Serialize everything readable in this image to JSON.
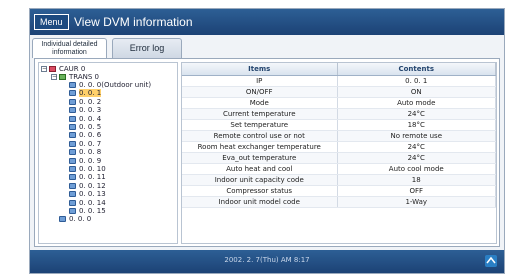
{
  "window": {
    "menu_label": "Menu",
    "title": "View DVM information"
  },
  "tabs": [
    {
      "label": "Individual detailed information",
      "active": true
    },
    {
      "label": "Error log",
      "active": false
    }
  ],
  "tree": {
    "root": "CAUR 0",
    "trans": "TRANS 0",
    "items": [
      "0. 0. 0(Outdoor unit)",
      "0. 0. 1",
      "0. 0. 2",
      "0. 0. 3",
      "0. 0. 4",
      "0. 0. 5",
      "0. 0. 6",
      "0. 0. 7",
      "0. 0. 8",
      "0. 0. 9",
      "0. 0. 10",
      "0. 0. 11",
      "0. 0. 12",
      "0. 0. 13",
      "0. 0. 14",
      "0. 0. 15",
      "0. 0. 0"
    ],
    "selected_index": 1
  },
  "table": {
    "headers": [
      "Items",
      "Contents"
    ],
    "rows": [
      [
        "IP",
        "0. 0. 1"
      ],
      [
        "ON/OFF",
        "ON"
      ],
      [
        "Mode",
        "Auto mode"
      ],
      [
        "Current temperature",
        "24°C"
      ],
      [
        "Set temperature",
        "18°C"
      ],
      [
        "Remote control use or not",
        "No remote use"
      ],
      [
        "Room heat exchanger temperature",
        "24°C"
      ],
      [
        "Eva_out temperature",
        "24°C"
      ],
      [
        "Auto heat and cool",
        "Auto cool mode"
      ],
      [
        "Indoor unit capacity code",
        "18"
      ],
      [
        "Compressor status",
        "OFF"
      ],
      [
        "Indoor unit model code",
        "1-Way"
      ]
    ]
  },
  "status": {
    "datetime": "2002. 2. 7(Thu) AM 8:17"
  },
  "colors": {
    "titlebar": "#1c4275",
    "selection": "#ffd06b",
    "header_text": "#24456e"
  }
}
